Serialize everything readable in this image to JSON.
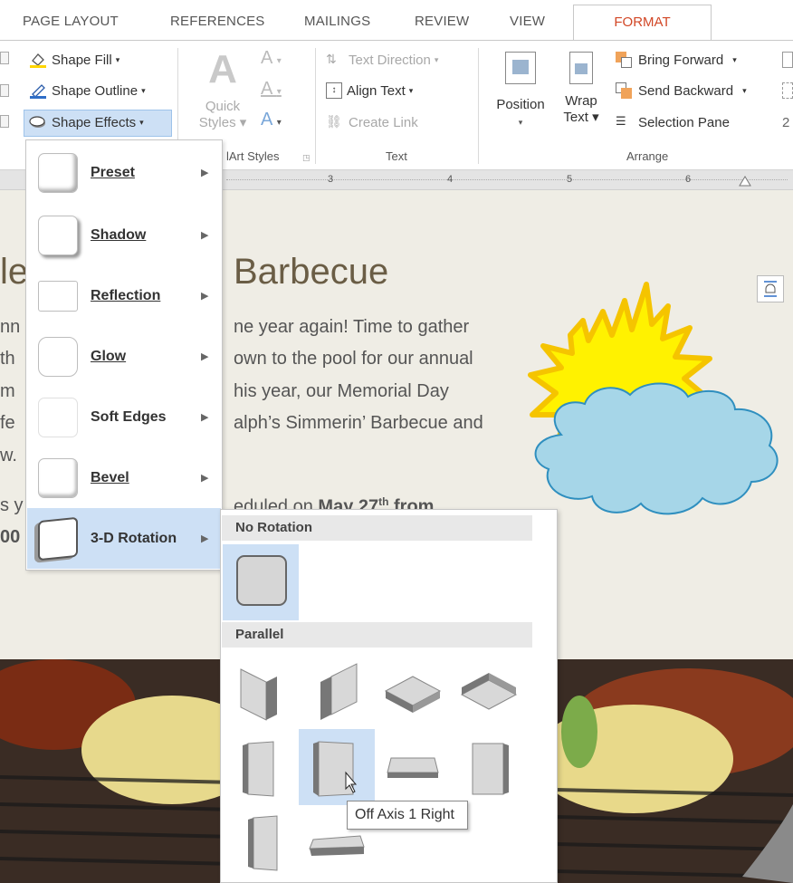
{
  "tabs": [
    {
      "label": "PAGE LAYOUT"
    },
    {
      "label": "REFERENCES"
    },
    {
      "label": "MAILINGS"
    },
    {
      "label": "REVIEW"
    },
    {
      "label": "VIEW"
    },
    {
      "label": "FORMAT",
      "active": true
    }
  ],
  "ribbon": {
    "shape_styles": {
      "shape_fill": "Shape Fill",
      "shape_outline": "Shape Outline",
      "shape_effects": "Shape Effects"
    },
    "wordart": {
      "quick_styles_1": "Quick",
      "quick_styles_2": "Styles",
      "group_label": "lArt Styles"
    },
    "text": {
      "text_direction": "Text Direction",
      "align_text": "Align Text",
      "create_link": "Create Link",
      "group_label": "Text"
    },
    "arrange": {
      "position": "Position",
      "wrap_1": "Wrap",
      "wrap_2": "Text",
      "bring_forward": "Bring Forward",
      "send_backward": "Send Backward",
      "selection_pane": "Selection Pane",
      "group_label": "Arrange"
    }
  },
  "ruler": {
    "marks": [
      "3",
      "4",
      "5",
      "6"
    ]
  },
  "document": {
    "title_right": "Barbecue",
    "title_left": "le",
    "lines_right": [
      "ne year again! Time to gather",
      "own to the pool for our annual",
      "his year, our Memorial Day",
      "alph’s Simmerin’ Barbecue and"
    ],
    "line_left": [
      "nn",
      "th",
      "m",
      "fe",
      "w.",
      "",
      "s y",
      "00"
    ],
    "line_date_pre": "eduled on ",
    "line_date_bold": "May 27",
    "line_date_sup": "th",
    "line_date_post": " from"
  },
  "effects_menu": {
    "items": [
      {
        "label": "Preset",
        "key": "P"
      },
      {
        "label": "Shadow",
        "key": "S"
      },
      {
        "label": "Reflection",
        "key": "R"
      },
      {
        "label": "Glow",
        "key": "G"
      },
      {
        "label": "Soft Edges",
        "key": "E"
      },
      {
        "label": "Bevel",
        "key": "B"
      },
      {
        "label": "3-D Rotation",
        "key": "D",
        "active": true
      }
    ]
  },
  "rotation_submenu": {
    "section_no_rotation": "No Rotation",
    "section_parallel": "Parallel",
    "tooltip": "Off Axis 1 Right",
    "selected": "Off Axis 1 Right"
  },
  "colors": {
    "format_tab": "#d24726",
    "menu_hover": "#cde0f5",
    "doc_background": "#efede5",
    "title_color": "#6a5d45",
    "sun_fill": "#fff200",
    "sun_outline": "#f5c400",
    "cloud_fill": "#a6d6e8",
    "cloud_outline": "#2f8fbf"
  }
}
